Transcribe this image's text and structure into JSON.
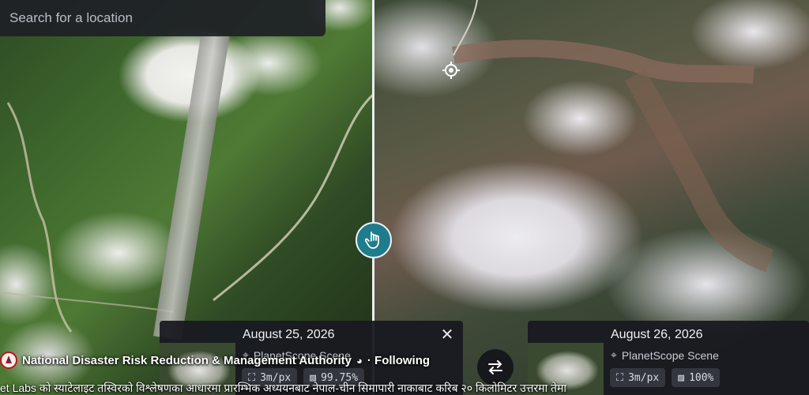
{
  "search": {
    "placeholder": "Search for a location"
  },
  "left_scene": {
    "date": "August 25, 2026",
    "source": "PlanetScope Scene",
    "resolution": "3m/px",
    "coverage": "99.75%"
  },
  "right_scene": {
    "date": "August 26, 2026",
    "source": "PlanetScope Scene",
    "resolution": "3m/px",
    "coverage": "100%"
  },
  "post": {
    "org_name": "National Disaster Risk Reduction & Management Authority",
    "follow_label": "· Following",
    "caption_text": "et Labs को स्याटेलाइट तस्विरको विश्लेषणका आधारमा प्रारम्भिक अध्ययनबाट नेपाल-चीन सिमापारी नाकाबाट करिब २० किलोमिटर उत्तरमा तेमा"
  },
  "icons": [
    "location-target-icon",
    "drag-hand-icon",
    "close-icon",
    "satellite-icon",
    "resolution-icon",
    "coverage-icon",
    "swap-arrows-icon",
    "nepal-emblem-icon",
    "globe-icon"
  ],
  "colors": {
    "handle": "#1e7c8c",
    "card_bg": "#181a20",
    "chip_bg": "#33363f"
  }
}
